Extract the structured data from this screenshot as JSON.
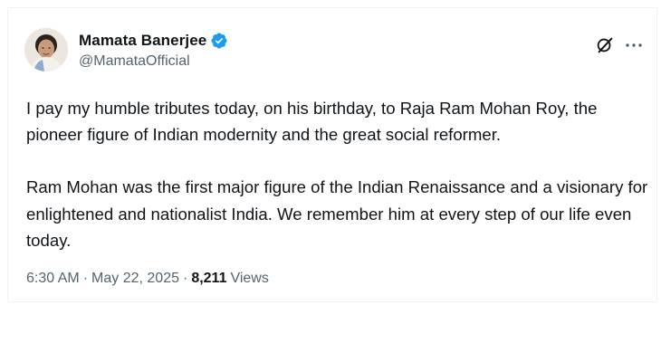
{
  "author": {
    "name": "Mamata Banerjee",
    "handle": "@MamataOfficial",
    "verified": true,
    "badge_color": "#1d9bf0"
  },
  "actions": {
    "grok_icon": "grok-icon",
    "more_icon": "more-options-icon"
  },
  "tweet": {
    "paragraphs": [
      "I pay my humble tributes today, on his birthday, to Raja Ram Mohan Roy, the pioneer figure of Indian modernity and the great social reformer.",
      "Ram Mohan was the first major figure of the Indian Renaissance and a visionary for enlightened and nationalist India. We remember him at every step of our life even today."
    ]
  },
  "meta": {
    "time": "6:30 AM",
    "dot1": "·",
    "date": "May 22, 2025",
    "dot2": "·",
    "views_count": "8,211",
    "views_label": "Views"
  },
  "colors": {
    "text_primary": "#0f1419",
    "text_secondary": "#536471",
    "border": "#eff3f4"
  }
}
